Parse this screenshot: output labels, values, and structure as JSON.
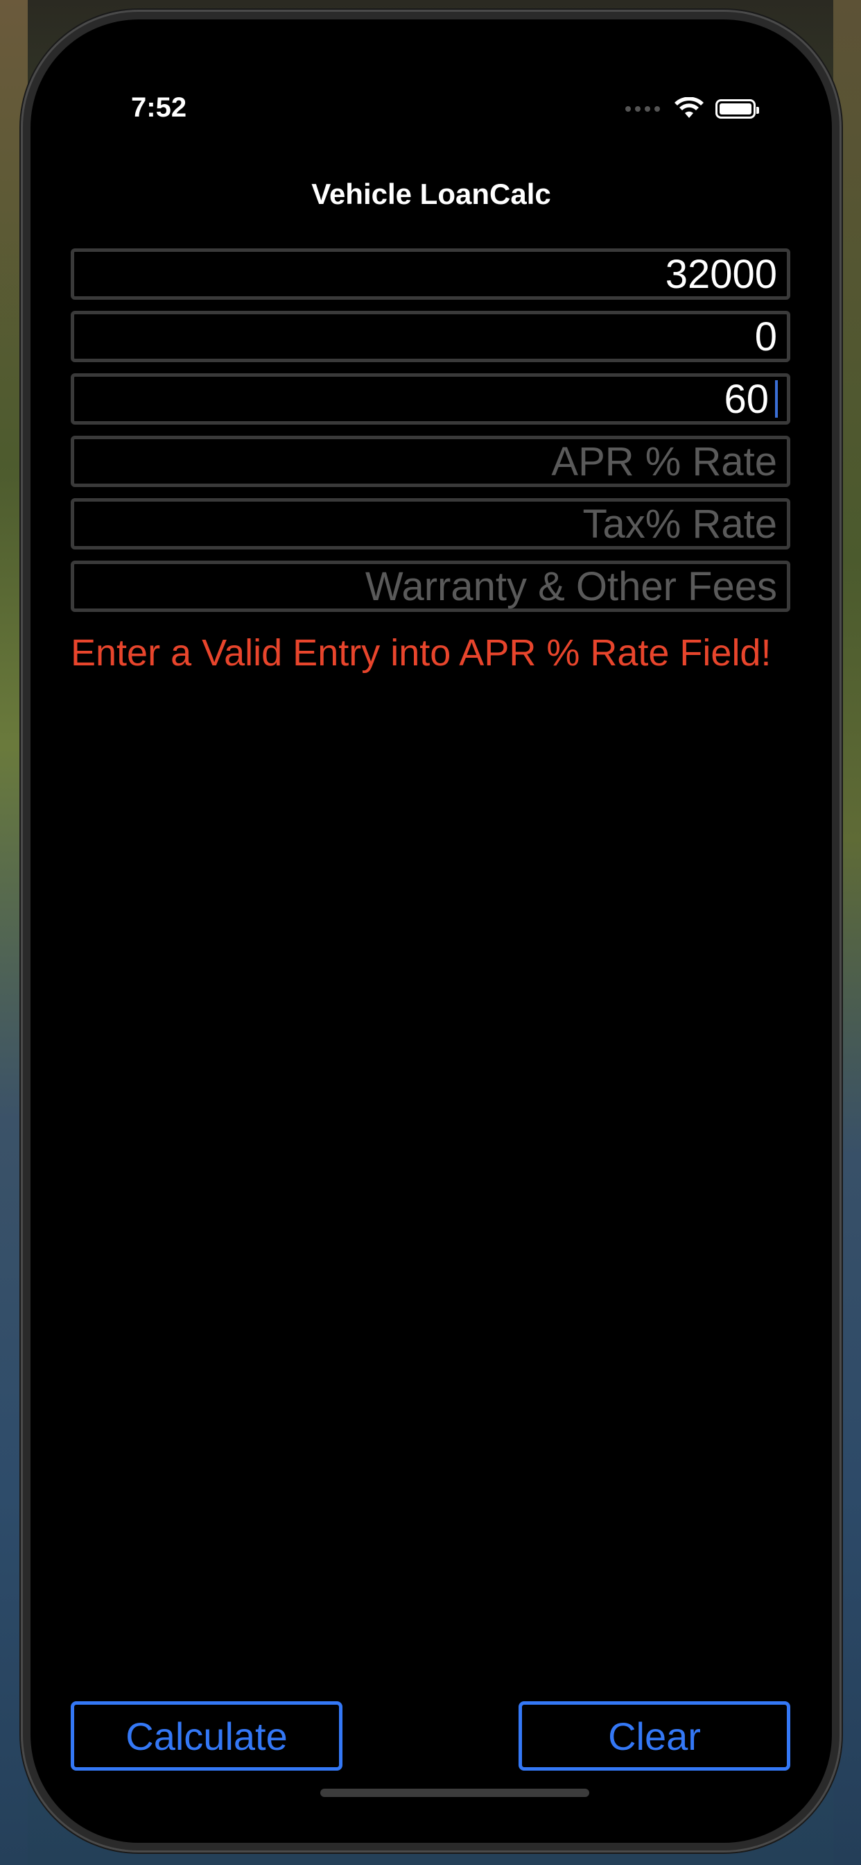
{
  "status_bar": {
    "time": "7:52",
    "icons": [
      "cellular-icon",
      "wifi-icon",
      "battery-icon"
    ]
  },
  "nav": {
    "title": "Vehicle LoanCalc"
  },
  "form": {
    "fields": [
      {
        "value": "32000",
        "placeholder": ""
      },
      {
        "value": "0",
        "placeholder": ""
      },
      {
        "value": "60",
        "placeholder": ""
      },
      {
        "value": "",
        "placeholder": "APR % Rate"
      },
      {
        "value": "",
        "placeholder": "Tax% Rate"
      },
      {
        "value": "",
        "placeholder": "Warranty & Other Fees"
      }
    ],
    "error_message": "Enter a Valid Entry into APR % Rate Field!"
  },
  "buttons": {
    "calculate_label": "Calculate",
    "clear_label": "Clear"
  },
  "colors": {
    "accent": "#3478f6",
    "error": "#e8452c",
    "background": "#000000",
    "field_border": "#3a3a3a",
    "placeholder": "#5a5a5a"
  }
}
